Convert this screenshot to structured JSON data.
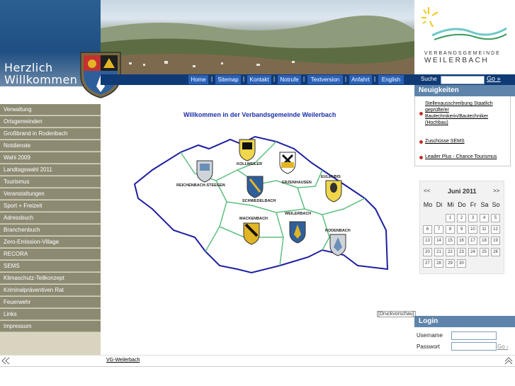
{
  "header": {
    "greeting_line1": "Herzlich",
    "greeting_line2": "Willkommen",
    "logo_line1": "VERBANDSGEMEINDE",
    "logo_line2": "WEILERBACH"
  },
  "nav": [
    "Home",
    "Sitemap",
    "Kontakt",
    "Notrufe",
    "Textversion",
    "Anfahrt",
    "English"
  ],
  "search": {
    "label": "Suche",
    "go": "Go »"
  },
  "sidebar": [
    "Verwaltung",
    "Ortsgemeinden",
    "Großbrand in Rodenbach",
    "Notdienste",
    "Wahl 2009",
    "Landtagswahl 2011",
    "Tourismus",
    "Veranstaltungen",
    "Sport + Freizeit",
    "Adressbuch",
    "Branchenbuch",
    "Zero-Emission-Village",
    "RECORA",
    "SEMS",
    "Klimaschutz-Teilkonzept",
    "Kriminalpräventiven Rat",
    "Feuerwehr",
    "Links",
    "Impressum"
  ],
  "main": {
    "title": "Willkommen in der Verbandsgemeinde Weilerbach",
    "map_labels": [
      "KOLLWEILER",
      "REICHENBACH-STEEGEN",
      "ERZENHAUSEN",
      "EULENBIS",
      "SCHWEDELBACH",
      "WEILERBACH",
      "MACKENBACH",
      "RODENBACH"
    ],
    "print_link": "[Druckvorschau]"
  },
  "news": {
    "title": "Neuigkeiten",
    "items": [
      "Stellenausschreibung Staatlich geprüfte/er Bautechnikerin/Bautechniker (Hochbau)",
      "Zuschüsse SEMS",
      "Leader Plus - Chance Tourismus"
    ]
  },
  "calendar": {
    "prev": "<<",
    "next": ">>",
    "month": "Juni 2011",
    "weekdays": [
      "Mo",
      "Di",
      "Mi",
      "Do",
      "Fr",
      "Sa",
      "So"
    ],
    "days": [
      "1",
      "2",
      "3",
      "4",
      "5",
      "6",
      "7",
      "8",
      "9",
      "10",
      "11",
      "12",
      "13",
      "14",
      "15",
      "16",
      "17",
      "18",
      "19",
      "20",
      "21",
      "22",
      "23",
      "24",
      "25",
      "26",
      "27",
      "28",
      "29",
      "30"
    ]
  },
  "login": {
    "title": "Login",
    "username_label": "Username",
    "password_label": "Passwort",
    "go": "Go ›"
  },
  "footer": {
    "link": "VG-Weilerbach"
  },
  "colors": {
    "nav_dark": "#0f3a75",
    "nav_button": "#2a61b8",
    "sidebar_item": "#8d8a72",
    "panel_title": "#5e84ab",
    "map_fill": "#ffffff",
    "map_border": "#1e1ea0",
    "inner_border": "#5fbf7f"
  }
}
